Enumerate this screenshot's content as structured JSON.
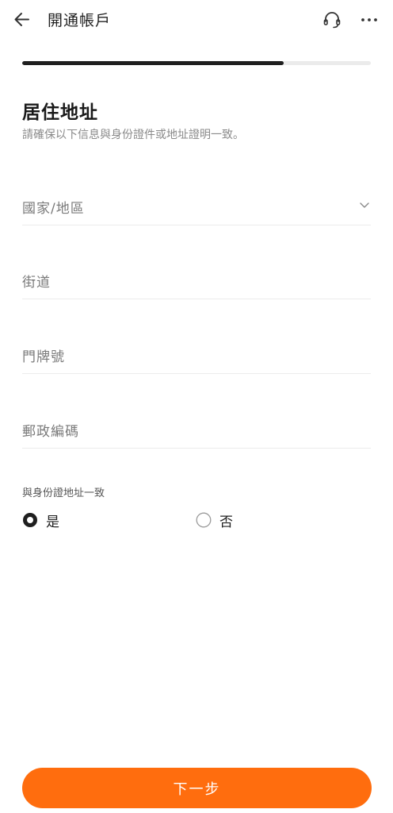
{
  "header": {
    "title": "開通帳戶",
    "back_icon": "arrow-left-icon",
    "support_icon": "headset-icon",
    "more_icon": "more-horizontal-icon"
  },
  "progress": {
    "fraction": 0.75
  },
  "section": {
    "title": "居住地址",
    "subtitle": "請確保以下信息與身份證件或地址證明一致。"
  },
  "fields": [
    {
      "placeholder": "國家/地區",
      "type": "select"
    },
    {
      "placeholder": "街道",
      "type": "text"
    },
    {
      "placeholder": "門牌號",
      "type": "text"
    },
    {
      "placeholder": "郵政編碼",
      "type": "text"
    }
  ],
  "same_as_id": {
    "label": "與身份證地址一致",
    "options": [
      {
        "label": "是",
        "selected": true
      },
      {
        "label": "否",
        "selected": false
      }
    ]
  },
  "footer": {
    "next_label": "下一步"
  },
  "colors": {
    "accent": "#ff6d0e",
    "progress": "#1f1f1f",
    "track": "#ebebeb",
    "placeholder": "#7a7a7a",
    "subtitle": "#8a8a8a"
  }
}
